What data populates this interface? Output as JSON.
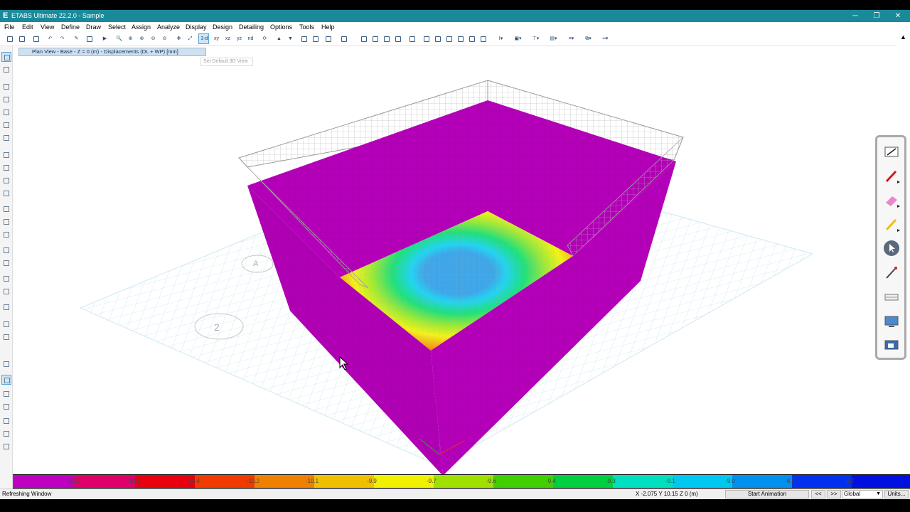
{
  "window": {
    "title": "ETABS Ultimate 22.2.0 - Sample",
    "app_icon": "E",
    "minimize": "─",
    "restore": "❐",
    "close": "✕"
  },
  "menu": [
    "File",
    "Edit",
    "View",
    "Define",
    "Draw",
    "Select",
    "Assign",
    "Analyze",
    "Display",
    "Design",
    "Detailing",
    "Options",
    "Tools",
    "Help"
  ],
  "toolbar": {
    "threed_label": "3-d",
    "xy_label": "xy",
    "xz_label": "xz",
    "yz_label": "yz",
    "nd_label": "nd"
  },
  "view": {
    "tab_title": "Plan View - Base - Z = 0 (m)  - Displacements (DL + WP)  [mm]",
    "tooltip": "Set Default 3D View",
    "grid_label_a": "A",
    "grid_label_2": "2"
  },
  "legend": {
    "labels": [
      "-10.7",
      "-10.5",
      "-10.4",
      "-10.2",
      "-10.1",
      "-9.9",
      "-9.7",
      "-9.6",
      "-9.4",
      "-9.3",
      "-9.1",
      "-9.0",
      "-8.8",
      "-8.7"
    ],
    "colors": [
      "#c000c0",
      "#e0006a",
      "#e80010",
      "#f03a00",
      "#f08000",
      "#f0c000",
      "#f0f000",
      "#a0e000",
      "#40d000",
      "#00d040",
      "#00e0c0",
      "#00c8f0",
      "#0090f0",
      "#0030f0",
      "#0010e0"
    ]
  },
  "status": {
    "message": "Refreshing Window",
    "coords": "X -2.075  Y 10.15  Z 0 (m)",
    "start_animation": "Start Animation",
    "prev": "<<",
    "next": ">>",
    "coord_system": "Global",
    "units": "Units..."
  },
  "colors": {
    "titlebar": "#1a8a9a",
    "wall": "#b400b8",
    "accent": "#5aa3d8"
  }
}
